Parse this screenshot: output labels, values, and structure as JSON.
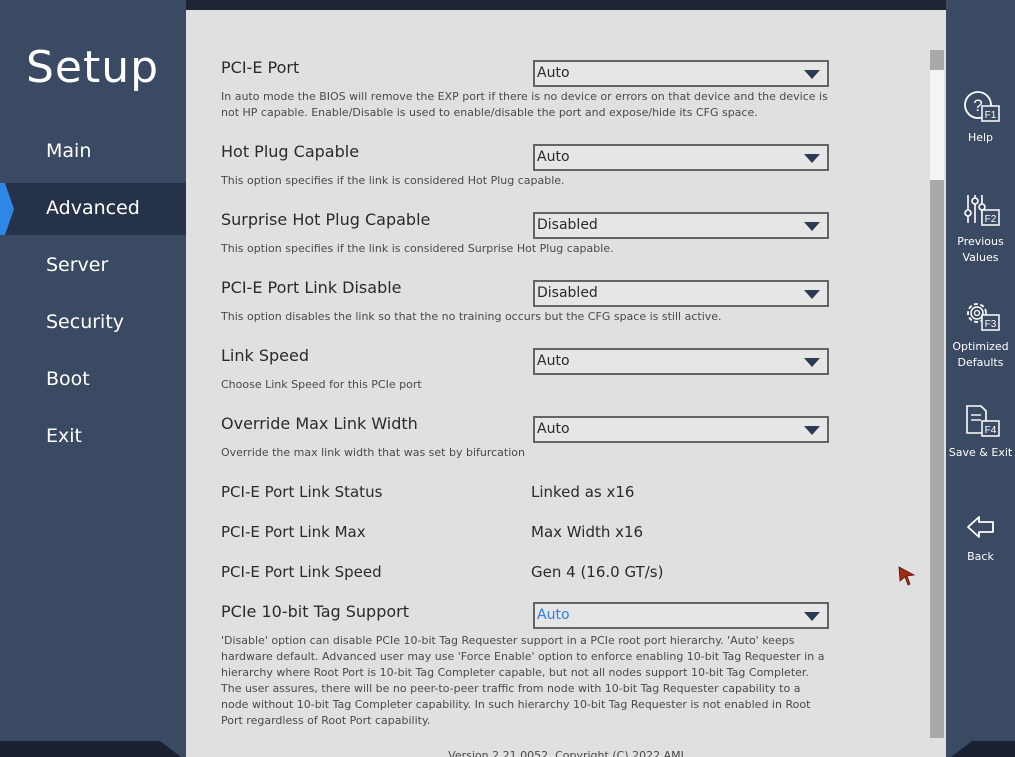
{
  "sidebar": {
    "title": "Setup",
    "items": [
      {
        "label": "Main"
      },
      {
        "label": "Advanced"
      },
      {
        "label": "Server"
      },
      {
        "label": "Security"
      },
      {
        "label": "Boot"
      },
      {
        "label": "Exit"
      }
    ],
    "active_item": "Advanced"
  },
  "settings": [
    {
      "label": "PCI-E Port",
      "value": "Auto",
      "help": "In auto mode the BIOS will remove the EXP port if there is no device or errors on that device and the device is not HP capable.  Enable/Disable is used to enable/disable the port and expose/hide its CFG space."
    },
    {
      "label": "Hot Plug Capable",
      "value": "Auto",
      "help": "This option specifies if the link is considered Hot Plug capable."
    },
    {
      "label": "Surprise Hot Plug Capable",
      "value": "Disabled",
      "help": "This option specifies if the link is considered Surprise Hot Plug capable."
    },
    {
      "label": "PCI-E Port Link Disable",
      "value": "Disabled",
      "help": "This option disables the link so that the no training occurs but the CFG space is still active."
    },
    {
      "label": "Link Speed",
      "value": "Auto",
      "help": "Choose Link Speed for this PCIe port"
    },
    {
      "label": "Override Max Link Width",
      "value": "Auto",
      "help": "Override the max link width that was set by bifurcation"
    }
  ],
  "status": [
    {
      "label": "PCI-E Port Link Status",
      "value": "Linked as x16"
    },
    {
      "label": "PCI-E Port Link Max",
      "value": "Max Width x16"
    },
    {
      "label": "PCI-E Port Link Speed",
      "value": "Gen 4 (16.0 GT/s)"
    }
  ],
  "tag_support": {
    "label": "PCIe 10-bit Tag Support",
    "value": "Auto",
    "help": "'Disable' option can disable PCIe 10-bit Tag Requester support in a PCIe root port hierarchy. 'Auto' keeps hardware default. Advanced user may use 'Force Enable' option to enforce enabling 10-bit Tag Requester in a hierarchy where Root Port is 10-bit Tag Completer capable, but not all nodes support 10-bit Tag Completer. The user assures, there will be no peer-to-peer traffic from node with 10-bit Tag Requester capability to a node without 10-bit Tag Completer capability. In such hierarchy 10-bit Tag Requester is not enabled in Root Port regardless of Root Port capability."
  },
  "toolbar": [
    {
      "label": "Help",
      "key": "F1",
      "icon": "help-icon"
    },
    {
      "label": "Previous Values",
      "key": "F2",
      "icon": "sliders-icon"
    },
    {
      "label": "Optimized Defaults",
      "key": "F3",
      "icon": "gear-icon"
    },
    {
      "label": "Save & Exit",
      "key": "F4",
      "icon": "save-document-icon"
    },
    {
      "label": "Back",
      "key": "",
      "icon": "back-arrow-icon"
    }
  ],
  "footer": {
    "text": "Version 2.21.0052. Copyright (C) 2022 AMI"
  },
  "colors": {
    "sidebar_bg": "#3a4a63",
    "active_bg": "#263248",
    "active_indicator": "#2e86e6",
    "content_bg": "#e0e0e0",
    "accent_value": "#2f7fe0"
  }
}
